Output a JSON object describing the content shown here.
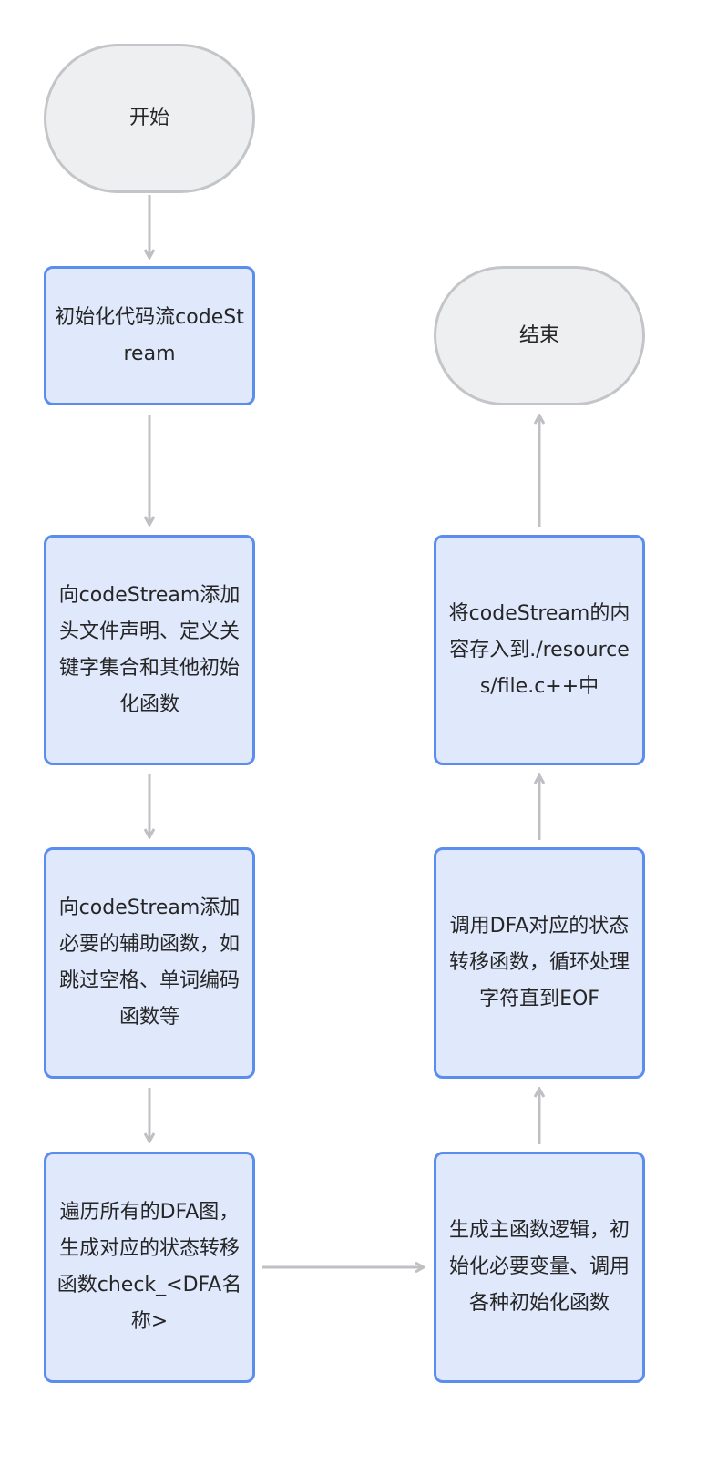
{
  "colors": {
    "process_fill": "#e0e8fc",
    "process_border": "#5b8def",
    "terminal_fill": "#eeeff1",
    "terminal_border": "#c4c5c8",
    "arrow": "#c0c0c4"
  },
  "nodes": {
    "start": "开始",
    "init_stream": "初始化代码流codeStream",
    "add_headers": "向codeStream添加头文件声明、定义关键字集合和其他初始化函数",
    "add_helpers": "向codeStream添加必要的辅助函数，如跳过空格、单词编码函数等",
    "traverse_dfa": "遍历所有的DFA图，生成对应的状态转移函数check_<DFA名称>",
    "main_logic": "生成主函数逻辑，初始化必要变量、调用各种初始化函数",
    "call_dfa": "调用DFA对应的状态转移函数，循环处理字符直到EOF",
    "save_file": "将codeStream的内容存入到./resources/file.c++中",
    "end": "结束"
  }
}
